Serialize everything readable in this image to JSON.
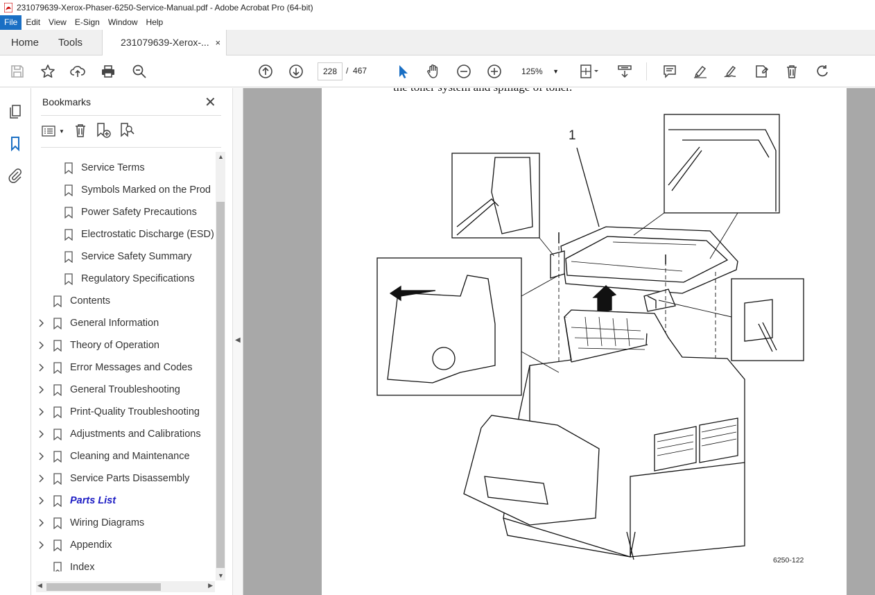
{
  "window": {
    "title": "231079639-Xerox-Phaser-6250-Service-Manual.pdf - Adobe Acrobat Pro (64-bit)"
  },
  "menu": [
    "File",
    "Edit",
    "View",
    "E-Sign",
    "Window",
    "Help"
  ],
  "tabs": {
    "home": "Home",
    "tools": "Tools",
    "document": "231079639-Xerox-...",
    "close_glyph": "×"
  },
  "toolbar": {
    "current_page": "228",
    "page_separator": "/",
    "total_pages": "467",
    "zoom": "125%"
  },
  "bookmarks_panel": {
    "title": "Bookmarks",
    "items": [
      {
        "label": "Service Terms",
        "level": 2,
        "expandable": false
      },
      {
        "label": "Symbols Marked on the Prod",
        "level": 2,
        "expandable": false
      },
      {
        "label": "Power Safety Precautions",
        "level": 2,
        "expandable": false
      },
      {
        "label": "Electrostatic Discharge (ESD)",
        "level": 2,
        "expandable": false
      },
      {
        "label": "Service Safety Summary",
        "level": 2,
        "expandable": false
      },
      {
        "label": "Regulatory Specifications",
        "level": 2,
        "expandable": false
      },
      {
        "label": "Contents",
        "level": 1,
        "expandable": false
      },
      {
        "label": "General Information",
        "level": 1,
        "expandable": true
      },
      {
        "label": "Theory of Operation",
        "level": 1,
        "expandable": true
      },
      {
        "label": "Error Messages and Codes",
        "level": 1,
        "expandable": true
      },
      {
        "label": "General Troubleshooting",
        "level": 1,
        "expandable": true
      },
      {
        "label": "Print-Quality Troubleshooting",
        "level": 1,
        "expandable": true
      },
      {
        "label": "Adjustments and Calibrations",
        "level": 1,
        "expandable": true
      },
      {
        "label": "Cleaning and Maintenance",
        "level": 1,
        "expandable": true
      },
      {
        "label": "Service Parts Disassembly",
        "level": 1,
        "expandable": true
      },
      {
        "label": "Parts List",
        "level": 1,
        "expandable": true,
        "current": true
      },
      {
        "label": "Wiring Diagrams",
        "level": 1,
        "expandable": true
      },
      {
        "label": "Appendix",
        "level": 1,
        "expandable": true
      },
      {
        "label": "Index",
        "level": 1,
        "expandable": false
      }
    ]
  },
  "document_page": {
    "cut_off_text": "the toner system and spillage of toner.",
    "callout": "1",
    "figure_id": "6250-122"
  },
  "colors": {
    "accent": "#1a6fc4",
    "current_bookmark": "#1c1cc4",
    "viewer_bg": "#a8a8a8"
  }
}
